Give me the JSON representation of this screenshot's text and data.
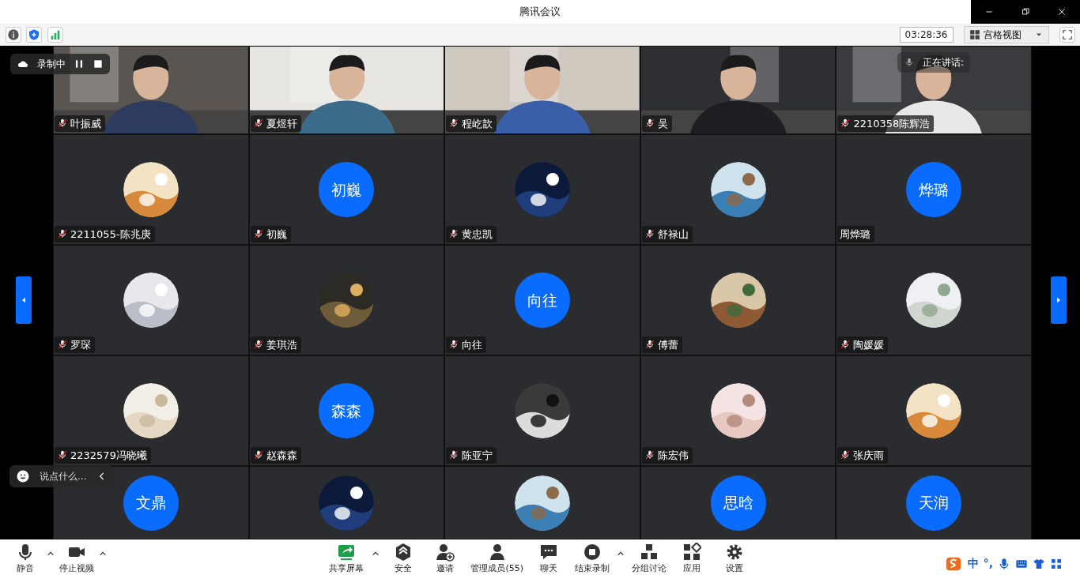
{
  "window": {
    "title": "腾讯会议"
  },
  "top_bar": {
    "time": "03:28:36",
    "view_mode": "宫格视图"
  },
  "recording": {
    "label": "录制中"
  },
  "speaking": {
    "label": "正在讲话:"
  },
  "chat_input": {
    "placeholder": "说点什么..."
  },
  "tiles": [
    {
      "kind": "video",
      "name": "叶振威",
      "muted": true
    },
    {
      "kind": "video",
      "name": "夏煜轩",
      "muted": true
    },
    {
      "kind": "video",
      "name": "程屹歆",
      "muted": true
    },
    {
      "kind": "video",
      "name": "吴",
      "muted": true
    },
    {
      "kind": "video",
      "name": "2210358陈辉浩",
      "muted": true
    },
    {
      "kind": "picture",
      "name": "2211055-陈兆庚",
      "muted": true
    },
    {
      "kind": "text",
      "avatar_text": "初巍",
      "name": "初巍",
      "muted": true
    },
    {
      "kind": "picture",
      "name": "黄忠凯",
      "muted": true
    },
    {
      "kind": "picture",
      "name": "舒禄山",
      "muted": true
    },
    {
      "kind": "text",
      "avatar_text": "烨璐",
      "name": "周烨璐",
      "muted": false
    },
    {
      "kind": "picture",
      "name": "罗琛",
      "muted": true
    },
    {
      "kind": "picture",
      "name": "姜琪浩",
      "muted": true
    },
    {
      "kind": "text",
      "avatar_text": "向往",
      "name": "向往",
      "muted": true
    },
    {
      "kind": "picture",
      "name": "傅蕾",
      "muted": true
    },
    {
      "kind": "picture",
      "name": "陶媛媛",
      "muted": true
    },
    {
      "kind": "picture",
      "name": "2232579冯晓曦",
      "muted": true
    },
    {
      "kind": "text",
      "avatar_text": "森森",
      "name": "赵森森",
      "muted": true
    },
    {
      "kind": "picture",
      "name": "陈亚宁",
      "muted": true
    },
    {
      "kind": "picture",
      "name": "陈宏伟",
      "muted": true
    },
    {
      "kind": "picture",
      "name": "张庆雨",
      "muted": true
    },
    {
      "kind": "text",
      "avatar_text": "文鼎"
    },
    {
      "kind": "picture"
    },
    {
      "kind": "picture"
    },
    {
      "kind": "text",
      "avatar_text": "思晗"
    },
    {
      "kind": "text",
      "avatar_text": "天润"
    }
  ],
  "toolbar_left": [
    {
      "label": "静音",
      "caret": true
    },
    {
      "label": "停止视频",
      "caret": true
    }
  ],
  "toolbar_center": [
    {
      "label": "共享屏幕",
      "caret": true
    },
    {
      "label": "安全",
      "caret": false
    },
    {
      "label": "邀请",
      "caret": false
    },
    {
      "label": "管理成员(55)",
      "caret": false
    },
    {
      "label": "聊天",
      "caret": false
    },
    {
      "label": "结束录制",
      "caret": true
    },
    {
      "label": "分组讨论",
      "caret": false
    },
    {
      "label": "应用",
      "caret": false
    },
    {
      "label": "设置",
      "caret": false
    }
  ],
  "ime_bar": {
    "mode": "中",
    "punct": "°,"
  }
}
